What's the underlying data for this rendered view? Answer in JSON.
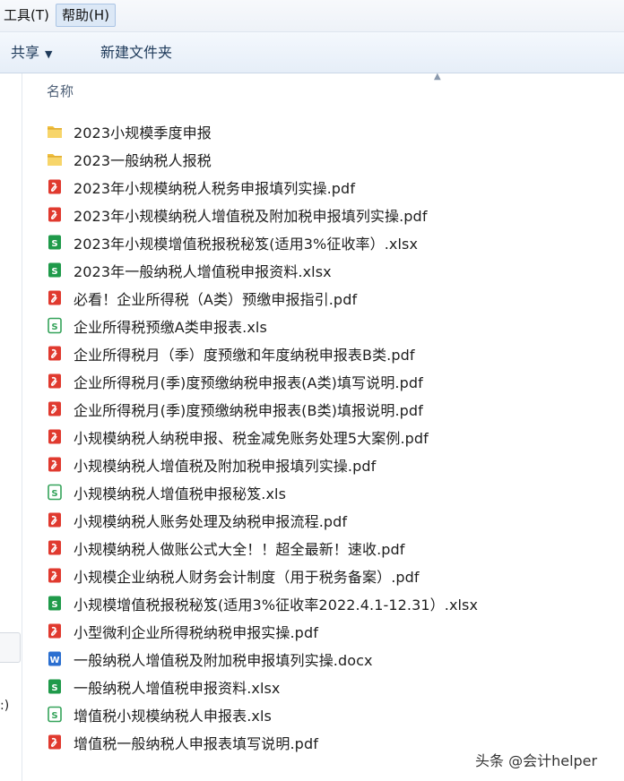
{
  "menu": {
    "tools_label": "工具(T)",
    "help_label": "帮助(H)"
  },
  "toolbar": {
    "share_label": "共享",
    "new_folder_label": "新建文件夹"
  },
  "nav": {
    "fragment_text": ":)"
  },
  "list": {
    "column_name": "名称",
    "files": [
      {
        "name": "2023小规模季度申报",
        "type": "folder"
      },
      {
        "name": "2023一般纳税人报税",
        "type": "folder"
      },
      {
        "name": "2023年小规模纳税人税务申报填列实操.pdf",
        "type": "pdf"
      },
      {
        "name": "2023年小规模纳税人增值税及附加税申报填列实操.pdf",
        "type": "pdf"
      },
      {
        "name": "2023年小规模增值税报税秘笈(适用3%征收率）.xlsx",
        "type": "xlsx"
      },
      {
        "name": "2023年一般纳税人增值税申报资料.xlsx",
        "type": "xlsx"
      },
      {
        "name": "必看！企业所得税（A类）预缴申报指引.pdf",
        "type": "pdf"
      },
      {
        "name": "企业所得税预缴A类申报表.xls",
        "type": "xls"
      },
      {
        "name": "企业所得税月（季）度预缴和年度纳税申报表B类.pdf",
        "type": "pdf"
      },
      {
        "name": "企业所得税月(季)度预缴纳税申报表(A类)填写说明.pdf",
        "type": "pdf"
      },
      {
        "name": "企业所得税月(季)度预缴纳税申报表(B类)填报说明.pdf",
        "type": "pdf"
      },
      {
        "name": "小规模纳税人纳税申报、税金减免账务处理5大案例.pdf",
        "type": "pdf"
      },
      {
        "name": "小规模纳税人增值税及附加税申报填列实操.pdf",
        "type": "pdf"
      },
      {
        "name": "小规模纳税人增值税申报秘笈.xls",
        "type": "xls"
      },
      {
        "name": "小规模纳税人账务处理及纳税申报流程.pdf",
        "type": "pdf"
      },
      {
        "name": "小规模纳税人做账公式大全！！超全最新！速收.pdf",
        "type": "pdf"
      },
      {
        "name": "小规模企业纳税人财务会计制度（用于税务备案）.pdf",
        "type": "pdf"
      },
      {
        "name": "小规模增值税报税秘笈(适用3%征收率2022.4.1-12.31）.xlsx",
        "type": "xlsx"
      },
      {
        "name": "小型微利企业所得税纳税申报实操.pdf",
        "type": "pdf"
      },
      {
        "name": "一般纳税人增值税及附加税申报填列实操.docx",
        "type": "docx"
      },
      {
        "name": "一般纳税人增值税申报资料.xlsx",
        "type": "xlsx"
      },
      {
        "name": "增值税小规模纳税人申报表.xls",
        "type": "xls"
      },
      {
        "name": "增值税一般纳税人申报表填写说明.pdf",
        "type": "pdf"
      }
    ]
  },
  "watermark": {
    "text": "头条 @会计helper"
  },
  "icons": {
    "folder": "folder-icon",
    "pdf": "pdf-file-icon",
    "xlsx": "xlsx-file-icon",
    "xls": "xls-file-icon",
    "docx": "docx-file-icon"
  },
  "colors": {
    "folder": "#f0bf3c",
    "pdf": "#e03a2f",
    "xlsx": "#1f9a4a",
    "xls": "#35a35a",
    "docx": "#2b6fd0"
  }
}
